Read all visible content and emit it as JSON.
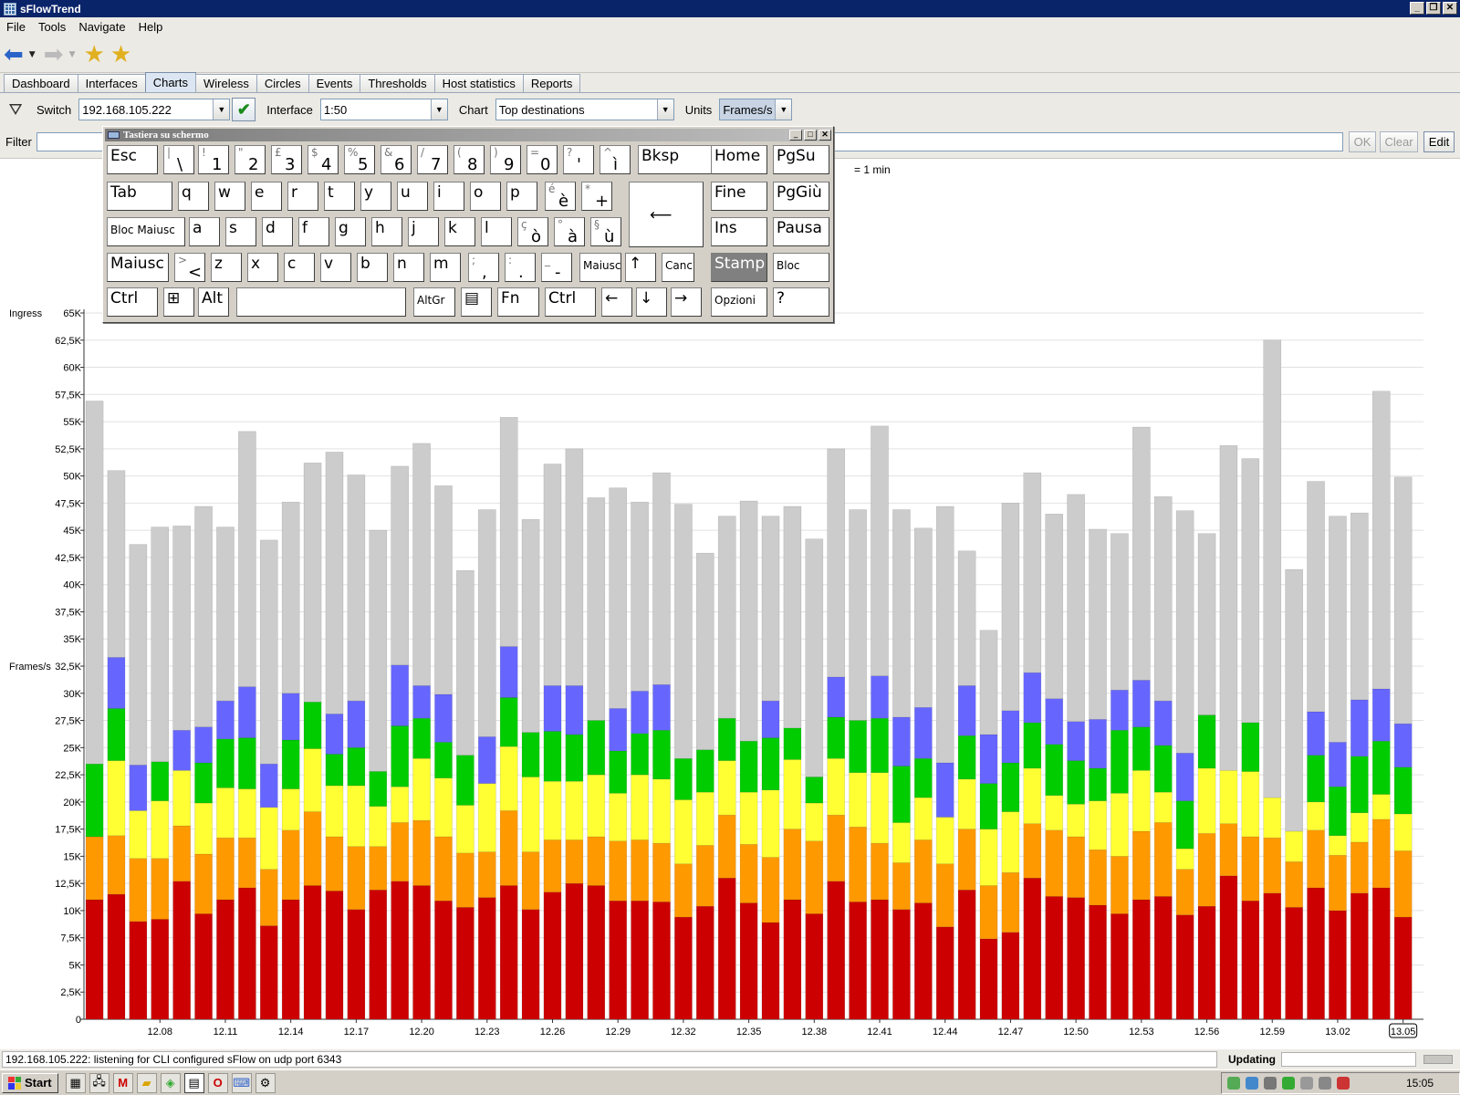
{
  "window": {
    "title": "sFlowTrend"
  },
  "menu": [
    "File",
    "Tools",
    "Navigate",
    "Help"
  ],
  "tabs": [
    "Dashboard",
    "Interfaces",
    "Charts",
    "Wireless",
    "Circles",
    "Events",
    "Thresholds",
    "Host statistics",
    "Reports"
  ],
  "active_tab": "Charts",
  "controls": {
    "switch_label": "Switch",
    "switch_value": "192.168.105.222",
    "interface_label": "Interface",
    "interface_value": "1:50",
    "chart_label": "Chart",
    "chart_value": "Top destinations",
    "units_label": "Units",
    "units_value": "Frames/s"
  },
  "filter": {
    "label": "Filter",
    "value": "",
    "ok": "OK",
    "clear": "Clear",
    "edit": "Edit"
  },
  "keyboard": {
    "title": "Tastiera su schermo",
    "rows": [
      [
        {
          "m": "Esc"
        },
        {
          "s": "|",
          "l": "\\"
        },
        {
          "s": "!",
          "l": "1"
        },
        {
          "s": "\"",
          "l": "2"
        },
        {
          "s": "£",
          "l": "3"
        },
        {
          "s": "$",
          "l": "4"
        },
        {
          "s": "%",
          "l": "5"
        },
        {
          "s": "&",
          "l": "6"
        },
        {
          "s": "/",
          "l": "7"
        },
        {
          "s": "(",
          "l": "8"
        },
        {
          "s": ")",
          "l": "9"
        },
        {
          "s": "=",
          "l": "0"
        },
        {
          "s": "?",
          "l": "'"
        },
        {
          "s": "^",
          "l": "ì"
        },
        {
          "m": "Bksp"
        },
        {
          "m": "Home"
        },
        {
          "m": "PgSu"
        }
      ],
      [
        {
          "m": "Tab"
        },
        {
          "m": "q"
        },
        {
          "m": "w"
        },
        {
          "m": "e"
        },
        {
          "m": "r"
        },
        {
          "m": "t"
        },
        {
          "m": "y"
        },
        {
          "m": "u"
        },
        {
          "m": "i"
        },
        {
          "m": "o"
        },
        {
          "m": "p"
        },
        {
          "s": "é",
          "l": "è"
        },
        {
          "s": "*",
          "l": "+"
        },
        {
          "m": "⟵"
        },
        {
          "m": "Fine"
        },
        {
          "m": "PgGiù"
        }
      ],
      [
        {
          "m": "Bloc Maiusc"
        },
        {
          "m": "a"
        },
        {
          "m": "s"
        },
        {
          "m": "d"
        },
        {
          "m": "f"
        },
        {
          "m": "g"
        },
        {
          "m": "h"
        },
        {
          "m": "j"
        },
        {
          "m": "k"
        },
        {
          "m": "l"
        },
        {
          "s": "ç",
          "l": "ò"
        },
        {
          "s": "°",
          "l": "à"
        },
        {
          "s": "§",
          "l": "ù"
        },
        {
          "m": "Ins"
        },
        {
          "m": "Pausa"
        }
      ],
      [
        {
          "m": "Maiusc"
        },
        {
          "s": ">",
          "l": "<"
        },
        {
          "m": "z"
        },
        {
          "m": "x"
        },
        {
          "m": "c"
        },
        {
          "m": "v"
        },
        {
          "m": "b"
        },
        {
          "m": "n"
        },
        {
          "m": "m"
        },
        {
          "s": ";",
          "l": ","
        },
        {
          "s": ":",
          "l": "."
        },
        {
          "s": "_",
          "l": "-"
        },
        {
          "m": "Maiusc"
        },
        {
          "m": "↑"
        },
        {
          "m": "Canc"
        },
        {
          "m": "Stamp"
        },
        {
          "m": "Bloc Scorr"
        }
      ],
      [
        {
          "m": "Ctrl"
        },
        {
          "m": "⊞"
        },
        {
          "m": "Alt"
        },
        {
          "m": ""
        },
        {
          "m": "AltGr"
        },
        {
          "m": "▤"
        },
        {
          "m": "Fn"
        },
        {
          "m": "Ctrl"
        },
        {
          "m": "←"
        },
        {
          "m": "↓"
        },
        {
          "m": "→"
        },
        {
          "m": "Opzioni"
        },
        {
          "m": "?"
        }
      ]
    ]
  },
  "chart_data": {
    "type": "bar",
    "stacked": true,
    "ylabel": "Frames/s",
    "y_side_label": "Ingress",
    "interval_note": "= 1 min",
    "ylim": [
      0,
      65000
    ],
    "yticks": [
      "0",
      "2,5K",
      "5K",
      "7,5K",
      "10K",
      "12,5K",
      "15K",
      "17,5K",
      "20K",
      "22,5K",
      "25K",
      "27,5K",
      "30K",
      "32,5K",
      "35K",
      "37,5K",
      "40K",
      "42,5K",
      "45K",
      "47,5K",
      "50K",
      "52,5K",
      "55K",
      "57,5K",
      "60K",
      "62,5K",
      "65K"
    ],
    "xticks": [
      "12.08",
      "12.11",
      "12.14",
      "12.17",
      "12.20",
      "12.23",
      "12.26",
      "12.29",
      "12.32",
      "12.35",
      "12.38",
      "12.41",
      "12.44",
      "12.47",
      "12.50",
      "12.53",
      "12.56",
      "12.59",
      "13.02",
      "13.05"
    ],
    "xtick_highlight": "13.05",
    "colors": {
      "red": "#cc0000",
      "orange": "#ff9900",
      "yellow": "#ffff33",
      "green": "#00cc00",
      "blue": "#6666ff",
      "gray": "#cccccc"
    },
    "series": [
      {
        "name": "red",
        "values": [
          11000,
          11500,
          9000,
          9200,
          12700,
          9700,
          11000,
          12100,
          8600,
          11000,
          12300,
          11800,
          10100,
          11900,
          12700,
          12300,
          10900,
          10300,
          11200,
          12300,
          10100,
          11700,
          12500,
          12300,
          10900,
          10900,
          10800,
          9400,
          10400,
          13000,
          10700,
          8900,
          11000,
          9700,
          12700,
          10800,
          11000,
          10100,
          10700,
          8500,
          11900,
          7400,
          8000,
          13000,
          11300,
          11200,
          10500,
          9700,
          11000,
          11300,
          9600,
          10400,
          13200,
          10900,
          11600,
          10300,
          12100,
          10000,
          11600,
          12100,
          9400
        ]
      },
      {
        "name": "orange",
        "values": [
          5800,
          5400,
          5800,
          5600,
          5100,
          5500,
          5700,
          4600,
          5200,
          6400,
          6800,
          5000,
          5800,
          4000,
          5400,
          6000,
          5900,
          5000,
          4200,
          6900,
          5300,
          4800,
          4000,
          4500,
          5500,
          5600,
          5400,
          4900,
          5600,
          5800,
          5400,
          6000,
          6500,
          6700,
          6100,
          6900,
          5200,
          4300,
          5800,
          5800,
          5600,
          4900,
          5500,
          5000,
          6100,
          5600,
          5100,
          5300,
          6300,
          6800,
          4200,
          6700,
          4800,
          5900,
          5100,
          4200,
          5300,
          5100,
          4700,
          6300,
          6100
        ]
      },
      {
        "name": "yellow",
        "values": [
          0,
          6900,
          4400,
          5300,
          5100,
          4700,
          4600,
          4500,
          5700,
          3800,
          5800,
          4700,
          5600,
          3700,
          3300,
          5700,
          5400,
          4400,
          6300,
          5900,
          6900,
          5400,
          5400,
          5700,
          4400,
          6000,
          5900,
          5900,
          4900,
          5000,
          4800,
          6200,
          6400,
          3500,
          5200,
          5000,
          6500,
          3700,
          3900,
          4300,
          4600,
          5200,
          5600,
          5100,
          3200,
          3000,
          4500,
          5800,
          5600,
          2800,
          1900,
          6000,
          4900,
          6000,
          3700,
          2800,
          2600,
          1800,
          2700,
          2300,
          3400
        ]
      },
      {
        "name": "green",
        "values": [
          6700,
          4800,
          0,
          3600,
          0,
          3700,
          4500,
          4700,
          0,
          4500,
          4300,
          2900,
          3500,
          3200,
          5600,
          3700,
          3300,
          4600,
          0,
          4500,
          4100,
          4600,
          4300,
          5000,
          3900,
          3800,
          4500,
          3800,
          3900,
          3900,
          4700,
          4800,
          2900,
          2400,
          3800,
          4800,
          5000,
          5200,
          3600,
          0,
          4000,
          4200,
          4500,
          4200,
          4700,
          4000,
          3000,
          5800,
          4000,
          4300,
          4400,
          4900,
          0,
          4500,
          0,
          0,
          4300,
          4500,
          5200,
          4900,
          4300
        ]
      },
      {
        "name": "blue",
        "values": [
          0,
          4700,
          4200,
          0,
          3700,
          3300,
          3500,
          4700,
          4000,
          4300,
          0,
          3700,
          4300,
          0,
          5600,
          3000,
          4400,
          0,
          4300,
          4700,
          0,
          4200,
          4500,
          0,
          3900,
          3900,
          4200,
          0,
          0,
          0,
          0,
          3400,
          0,
          0,
          3700,
          0,
          3900,
          4500,
          4700,
          5000,
          4600,
          4500,
          4800,
          4600,
          4200,
          3600,
          4500,
          3700,
          4300,
          4100,
          4400,
          0,
          0,
          0,
          0,
          0,
          4000,
          4100,
          5200,
          4800,
          4000
        ]
      },
      {
        "name": "gray",
        "values": [
          33400,
          17200,
          20300,
          21600,
          18800,
          20300,
          16000,
          23500,
          20600,
          17600,
          22000,
          24100,
          20800,
          22200,
          18300,
          22300,
          19200,
          17000,
          20900,
          21100,
          19600,
          20400,
          21800,
          20500,
          20300,
          17400,
          19500,
          23400,
          18100,
          18600,
          22100,
          17000,
          20400,
          21900,
          21000,
          19400,
          23000,
          19100,
          16500,
          23600,
          12400,
          9600,
          19100,
          18400,
          17000,
          20900,
          17500,
          14400,
          23300,
          18800,
          22300,
          16700,
          29900,
          24300,
          42100,
          24100,
          21200,
          20800,
          17200,
          27400,
          22700
        ]
      }
    ]
  },
  "status": {
    "message": "192.168.105.222: listening for CLI configured sFlow on udp port 6343",
    "updating": "Updating"
  },
  "taskbar": {
    "start": "Start",
    "clock": "15:05"
  }
}
